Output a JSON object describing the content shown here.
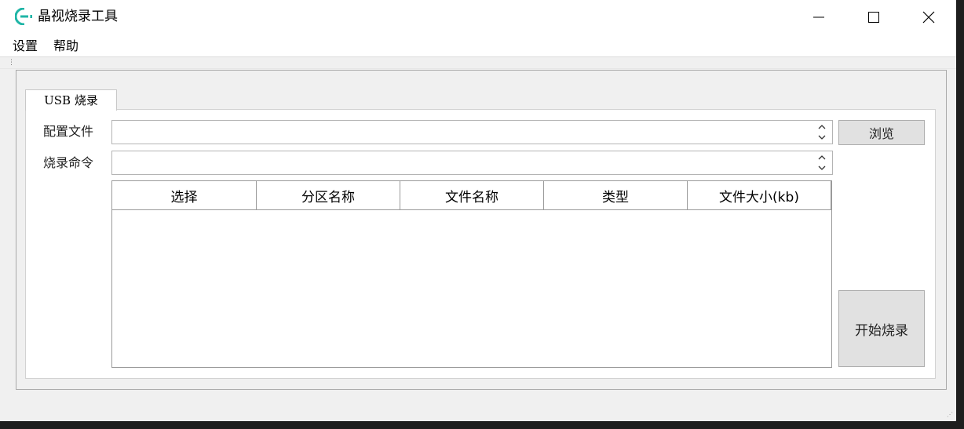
{
  "window": {
    "title": "晶视烧录工具",
    "brand_color": "#1fb5a6"
  },
  "menu": {
    "items": [
      "设置",
      "帮助"
    ]
  },
  "tabs": [
    {
      "label": "USB 烧录",
      "active": true
    }
  ],
  "form": {
    "config_label": "配置文件",
    "config_value": "",
    "command_label": "烧录命令",
    "command_value": "",
    "browse_button": "浏览"
  },
  "table": {
    "columns": [
      "选择",
      "分区名称",
      "文件名称",
      "类型",
      "文件大小(kb)"
    ],
    "rows": []
  },
  "actions": {
    "start_button": "开始烧录"
  }
}
